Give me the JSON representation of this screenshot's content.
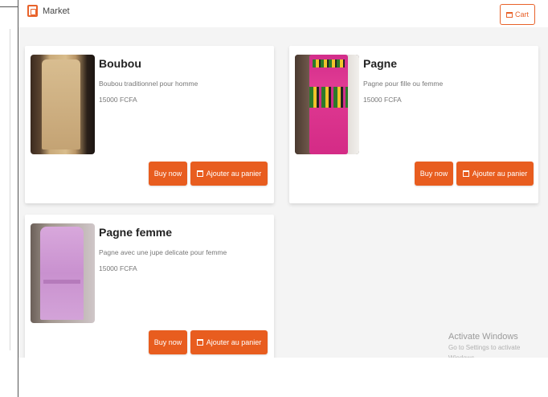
{
  "app": {
    "brand": "Market",
    "cart_label": "Cart"
  },
  "products": [
    {
      "title": "Boubou",
      "description": "Boubou traditionnel pour homme",
      "price": "15000 FCFA",
      "buy_label": "Buy now",
      "add_label": "Ajouter au panier"
    },
    {
      "title": "Pagne",
      "description": "Pagne pour fille ou femme",
      "price": "15000 FCFA",
      "buy_label": "Buy now",
      "add_label": "Ajouter au panier"
    },
    {
      "title": "Pagne femme",
      "description": "Pagne avec une jupe delicate pour femme",
      "price": "15000 FCFA",
      "buy_label": "Buy now",
      "add_label": "Ajouter au panier"
    }
  ],
  "watermark": {
    "title": "Activate Windows",
    "subtitle": "Go to Settings to activate Windows."
  },
  "colors": {
    "accent": "#e85d1f",
    "background": "#f4f4f4",
    "card": "#ffffff"
  }
}
